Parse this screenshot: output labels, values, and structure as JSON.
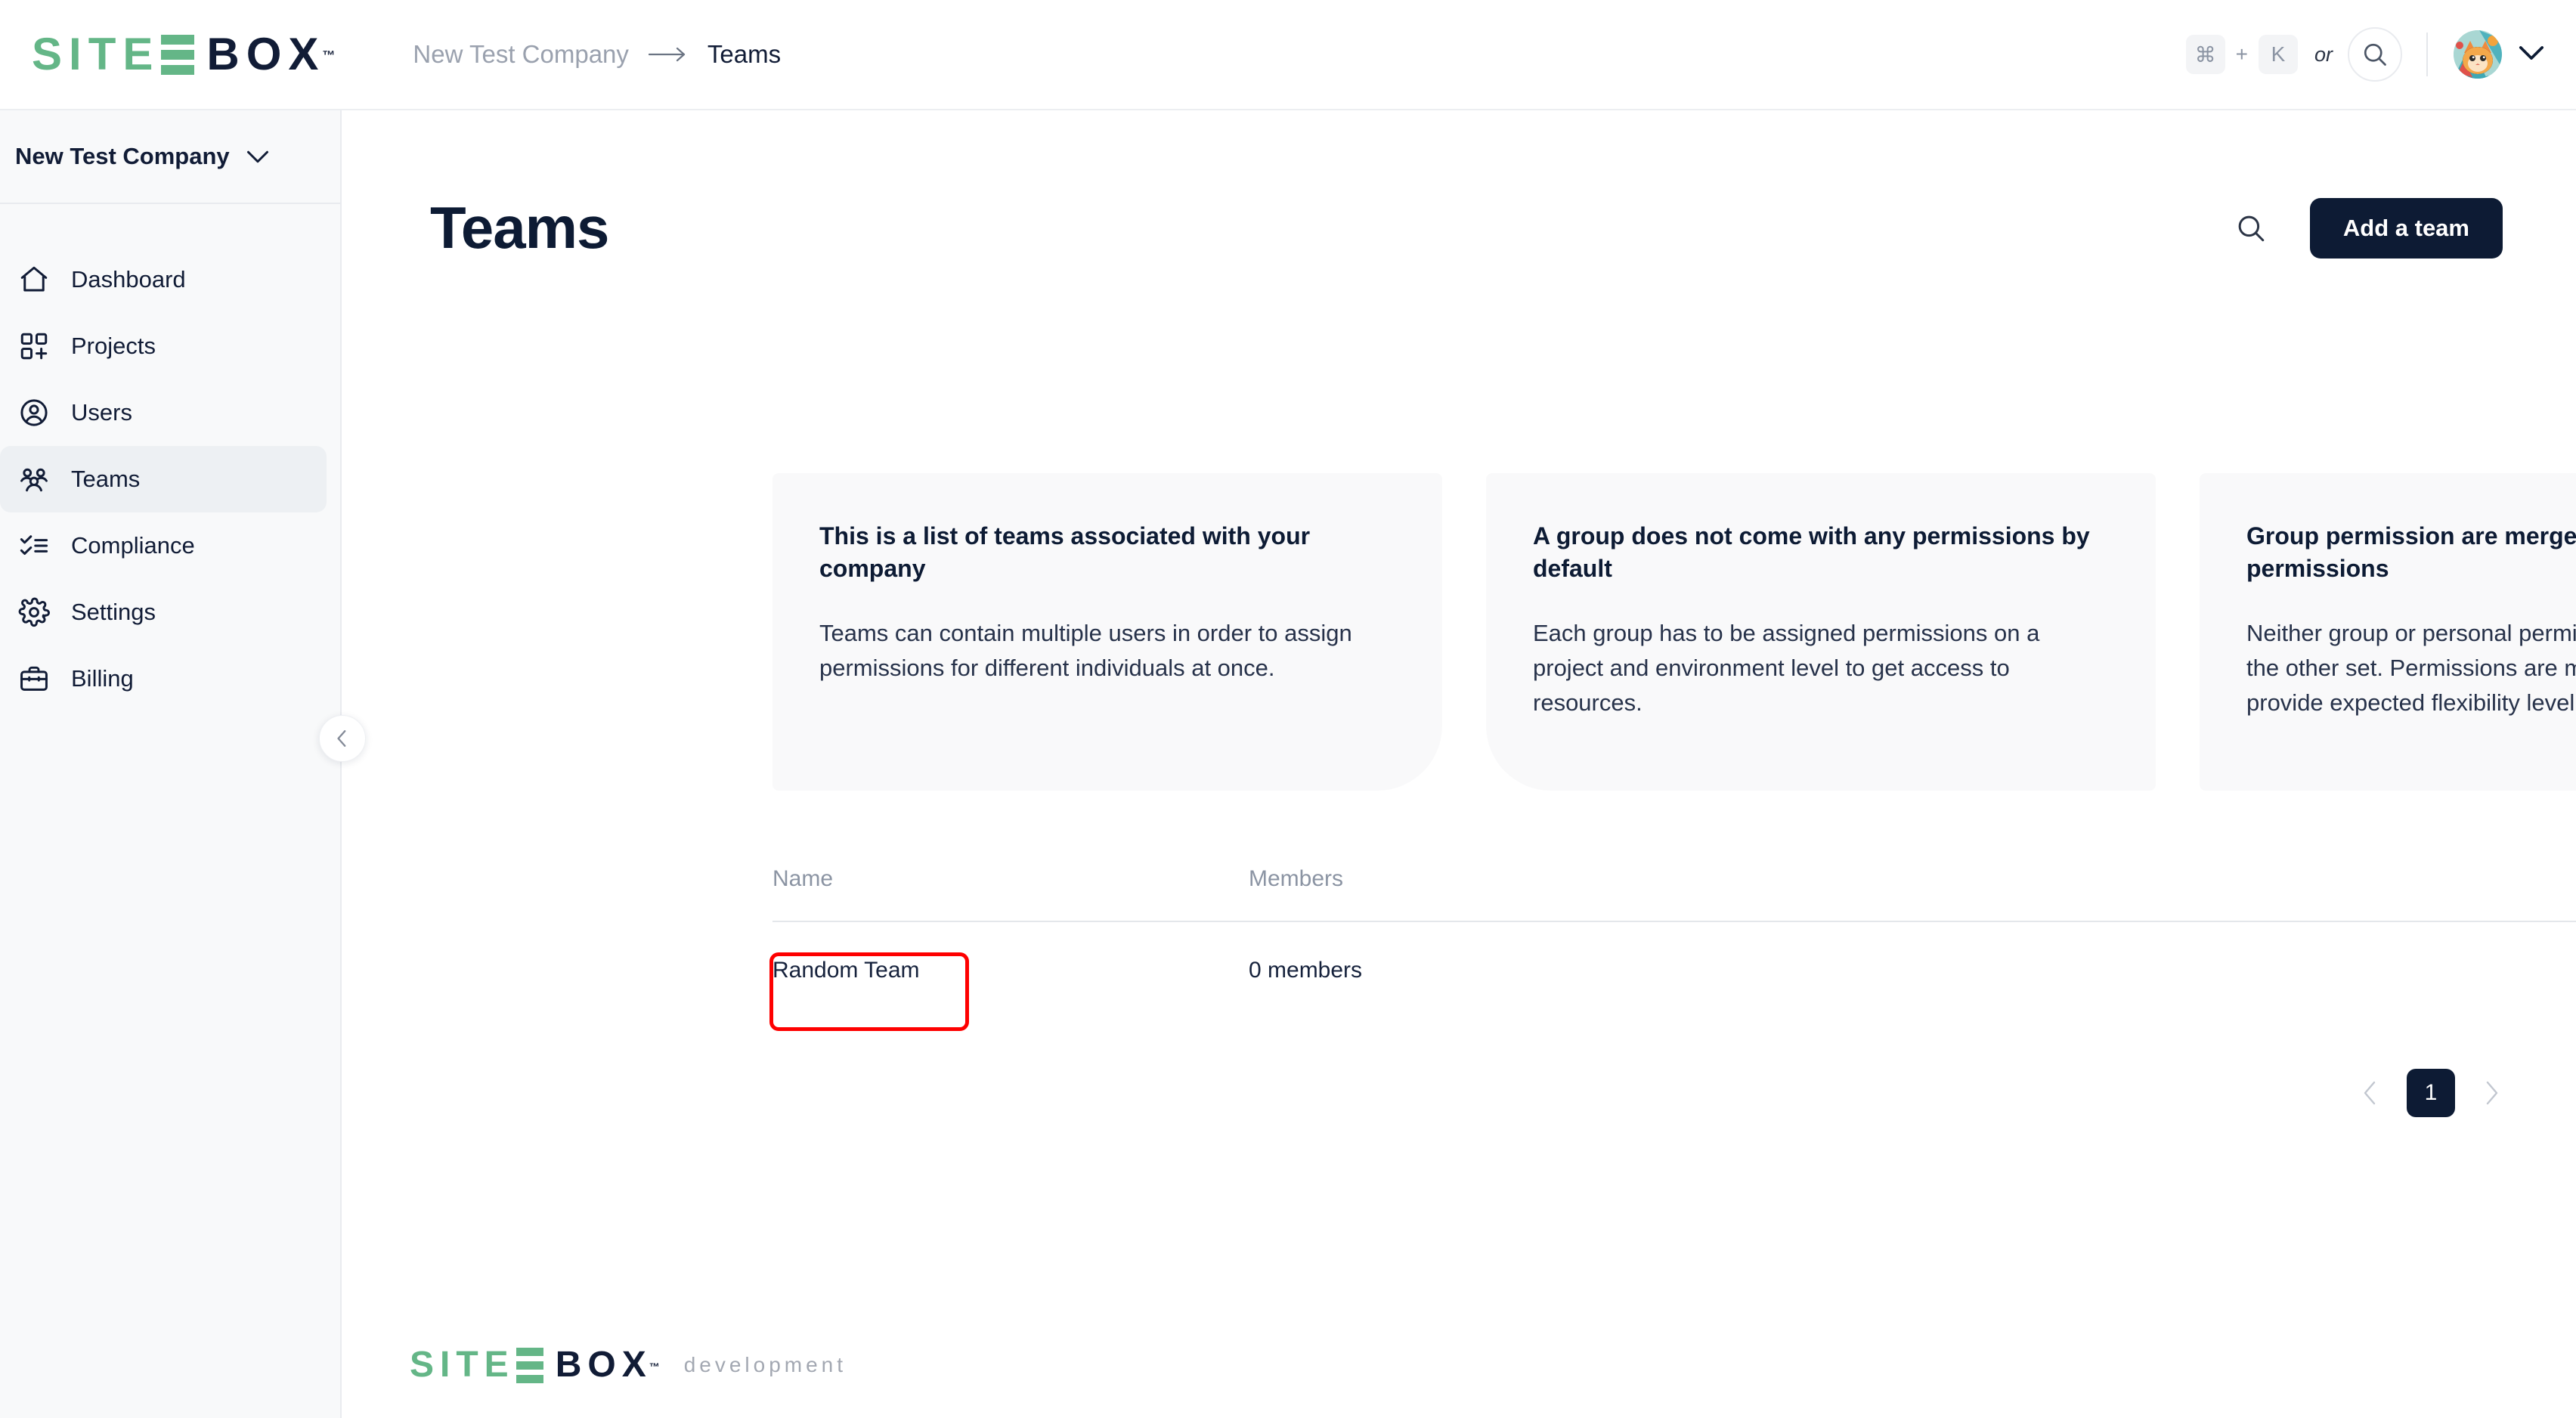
{
  "brand": {
    "part_green": "SITE",
    "part_dark": "BOX",
    "trademark": "™"
  },
  "topbar": {
    "breadcrumb": {
      "company": "New Test Company",
      "separator": "→",
      "current": "Teams"
    },
    "shortcut": {
      "cmd_key": "⌘",
      "plus": "+",
      "letter_key": "K",
      "or_label": "or"
    }
  },
  "sidebar": {
    "company_switcher": {
      "label": "New Test Company"
    },
    "items": [
      {
        "label": "Dashboard",
        "icon": "home-icon",
        "active": false
      },
      {
        "label": "Projects",
        "icon": "grid-plus-icon",
        "active": false
      },
      {
        "label": "Users",
        "icon": "user-circle-icon",
        "active": false
      },
      {
        "label": "Teams",
        "icon": "users-group-icon",
        "active": true
      },
      {
        "label": "Compliance",
        "icon": "checklist-icon",
        "active": false
      },
      {
        "label": "Settings",
        "icon": "gear-icon",
        "active": false
      },
      {
        "label": "Billing",
        "icon": "briefcase-icon",
        "active": false
      }
    ]
  },
  "main": {
    "title": "Teams",
    "add_button": "Add a team",
    "cards": [
      {
        "title": "This is a list of teams associated with your company",
        "body": "Teams can contain multiple users in order to assign permissions for different individuals at once."
      },
      {
        "title": "A group does not come with any permissions by default",
        "body": "Each group has to be assigned permissions on a project and environment level to get access to resources."
      },
      {
        "title": "Group permission are merged with personal permissions",
        "body": "Neither group or personal permissions does override the other set. Permissions are merged dynamically to provide expected flexibility level."
      }
    ],
    "table": {
      "columns": [
        "Name",
        "Members"
      ],
      "rows": [
        {
          "name": "Random Team",
          "members": "0 members"
        }
      ]
    },
    "pagination": {
      "prev": "‹",
      "current_page": "1",
      "next": "›"
    }
  },
  "footer": {
    "word": "development"
  },
  "colors": {
    "brand_green": "#64b687",
    "brand_navy": "#111c36",
    "accent_dark": "#0d1b34",
    "muted_text": "#8b94a3",
    "card_bg": "#f9f9fa",
    "highlight_red": "#fe0000"
  }
}
